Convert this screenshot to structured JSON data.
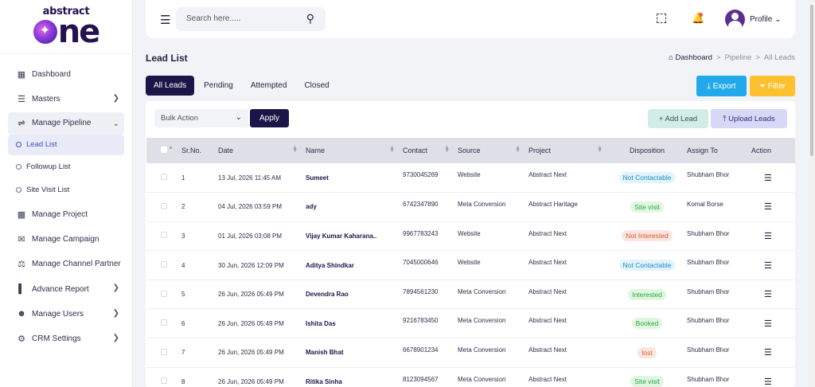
{
  "brand": {
    "top": "abstract",
    "main": "ne"
  },
  "sidebar": {
    "items": [
      {
        "label": "Dashboard",
        "icon": "grid-icon"
      },
      {
        "label": "Masters",
        "icon": "list-icon"
      },
      {
        "label": "Manage Pipeline",
        "icon": "pipeline-icon"
      },
      {
        "label": "Manage Project",
        "icon": "building-icon"
      },
      {
        "label": "Manage Campaign",
        "icon": "megaphone-icon"
      },
      {
        "label": "Manage Channel Partner",
        "icon": "handshake-icon"
      },
      {
        "label": "Advance Report",
        "icon": "bar-chart-icon"
      },
      {
        "label": "Manage Users",
        "icon": "users-icon"
      },
      {
        "label": "CRM Settings",
        "icon": "gear-icon"
      }
    ],
    "sub_items": [
      "Lead List",
      "Followup List",
      "Site Visit List"
    ]
  },
  "header": {
    "search_placeholder": "Search here.....",
    "profile_label": "Profile"
  },
  "page": {
    "title": "Lead List",
    "breadcrumb": [
      "Dashboard",
      "Pipeline",
      "All Leads"
    ],
    "breadcrumb_sep": ">"
  },
  "tabs": [
    "All Leads",
    "Pending",
    "Attempted",
    "Closed"
  ],
  "buttons": {
    "export": "Export",
    "filter": "Filter",
    "bulk_action": "Bulk Action",
    "apply": "Apply",
    "add_lead": "+ Add Lead",
    "upload_leads": "Upload Leads"
  },
  "table": {
    "columns": [
      "Sr.No.",
      "Date",
      "Name",
      "Contact",
      "Source",
      "Project",
      "Disposition",
      "Assign To",
      "Action"
    ],
    "rows": [
      {
        "sr": "1",
        "date": "13 Jul, 2026 11:45 AM",
        "name": "Sumeet",
        "contact": "9730045269",
        "source": "Website",
        "project": "Abstract Next",
        "disposition": "Not Contactable",
        "assign": "Shubham Bhor"
      },
      {
        "sr": "2",
        "date": "04 Jul, 2026 03:59 PM",
        "name": "ady",
        "contact": "6742347890",
        "source": "Meta Conversion",
        "project": "Abstract Haritage",
        "disposition": "Site visit",
        "assign": "Komal Borse"
      },
      {
        "sr": "3",
        "date": "01 Jul, 2026 03:08 PM",
        "name": "Vijay Kumar Kaharana..",
        "contact": "9967783243",
        "source": "Website",
        "project": "Abstract Next",
        "disposition": "Not Interested",
        "assign": "Shubham Bhor"
      },
      {
        "sr": "4",
        "date": "30 Jun, 2026 12:09 PM",
        "name": "Aditya Shindkar",
        "contact": "7045000646",
        "source": "Website",
        "project": "Abstract Next",
        "disposition": "Not Contactable",
        "assign": "Shubham Bhor"
      },
      {
        "sr": "5",
        "date": "26 Jun, 2026 05:49 PM",
        "name": "Devendra Rao",
        "contact": "7894561230",
        "source": "Meta Conversion",
        "project": "Abstract Next",
        "disposition": "Interested",
        "assign": "Shubham Bhor"
      },
      {
        "sr": "6",
        "date": "26 Jun, 2026 05:49 PM",
        "name": "Ishita Das",
        "contact": "9216783450",
        "source": "Meta Conversion",
        "project": "Abstract Next",
        "disposition": "Booked",
        "assign": "Shubham Bhor"
      },
      {
        "sr": "7",
        "date": "26 Jun, 2026 05:49 PM",
        "name": "Manish Bhat",
        "contact": "6678901234",
        "source": "Meta Conversion",
        "project": "Abstract Next",
        "disposition": "lost",
        "assign": "Shubham Bhor"
      },
      {
        "sr": "8",
        "date": "26 Jun, 2026 05:49 PM",
        "name": "Ritika Sinha",
        "contact": "8123094567",
        "source": "Meta Conversion",
        "project": "Abstract Next",
        "disposition": "Site visit",
        "assign": "Shubham Bhor"
      }
    ]
  },
  "colors": {
    "primary": "#1c1547",
    "export": "#21a9ec",
    "filter": "#fdc02f",
    "active_link": "#3b4fc4"
  }
}
